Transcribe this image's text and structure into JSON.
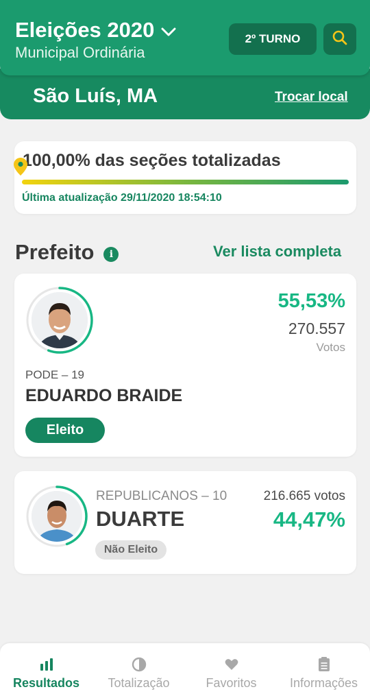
{
  "header": {
    "title": "Eleições 2020",
    "subtitle": "Municipal Ordinária",
    "turno_label": "2º TURNO",
    "location": "São Luís, MA",
    "change_location": "Trocar local"
  },
  "status": {
    "sections_text": "100,00% das seções totalizadas",
    "progress_fraction": 1.0,
    "last_update": "Última atualização 29/11/2020 18:54:10"
  },
  "section": {
    "title": "Prefeito",
    "see_full_list": "Ver lista completa"
  },
  "candidates": [
    {
      "party": "PODE – 19",
      "name": "EDUARDO BRAIDE",
      "percent": "55,53%",
      "percent_value": 55.53,
      "votes": "270.557",
      "votes_label": "Votos",
      "status": "Eleito"
    },
    {
      "party": "REPUBLICANOS – 10",
      "name": "DUARTE",
      "percent": "44,47%",
      "percent_value": 44.47,
      "votes": "216.665 votos",
      "status": "Não Eleito"
    }
  ],
  "nav": {
    "items": [
      {
        "label": "Resultados",
        "icon": "bar-chart-icon",
        "active": true
      },
      {
        "label": "Totalização",
        "icon": "pie-chart-icon",
        "active": false
      },
      {
        "label": "Favoritos",
        "icon": "heart-icon",
        "active": false
      },
      {
        "label": "Informações",
        "icon": "document-icon",
        "active": false
      }
    ]
  },
  "colors": {
    "primary": "#1b9b6e",
    "primary_dark": "#178a60",
    "accent_percent": "#18b784",
    "location_pin": "#f5c518"
  }
}
